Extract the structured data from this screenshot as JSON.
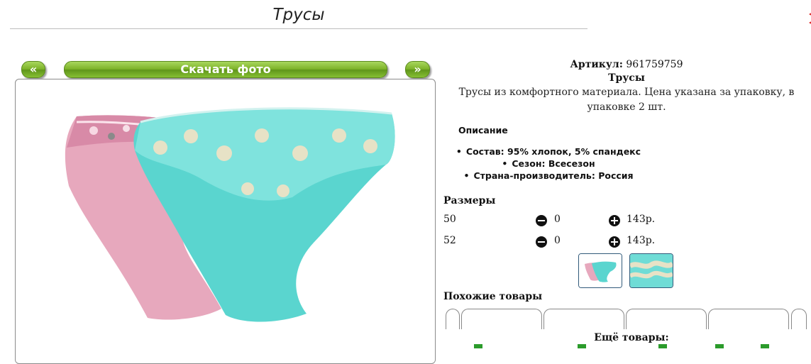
{
  "page": {
    "title": "Трусы",
    "close_icon": "close-icon"
  },
  "gallery": {
    "prev_label": "«",
    "download_label": "Скачать фото",
    "next_label": "»",
    "image_icon": "product-photo"
  },
  "product": {
    "sku_label": "Артикул:",
    "sku_value": "961759759",
    "name": "Трусы",
    "description": "Трусы из комфортного материала. Цена указана за упаковку, в упаковке 2 шт.",
    "description_title": "Описание",
    "features": [
      "Состав: 95% хлопок, 5% спандекс",
      "Сезон: Всесезон",
      "Страна-производитель: Россия"
    ]
  },
  "sizes": {
    "title": "Размеры",
    "rows": [
      {
        "size": "50",
        "qty": "0",
        "price": "143р."
      },
      {
        "size": "52",
        "qty": "0",
        "price": "143р."
      }
    ]
  },
  "similar": {
    "title": "Похожие товары",
    "more_title": "Ещё товары:"
  },
  "colors": {
    "accent_green": "#7cb228",
    "pink": "#e6a0b8",
    "turquoise": "#56d3cf"
  }
}
